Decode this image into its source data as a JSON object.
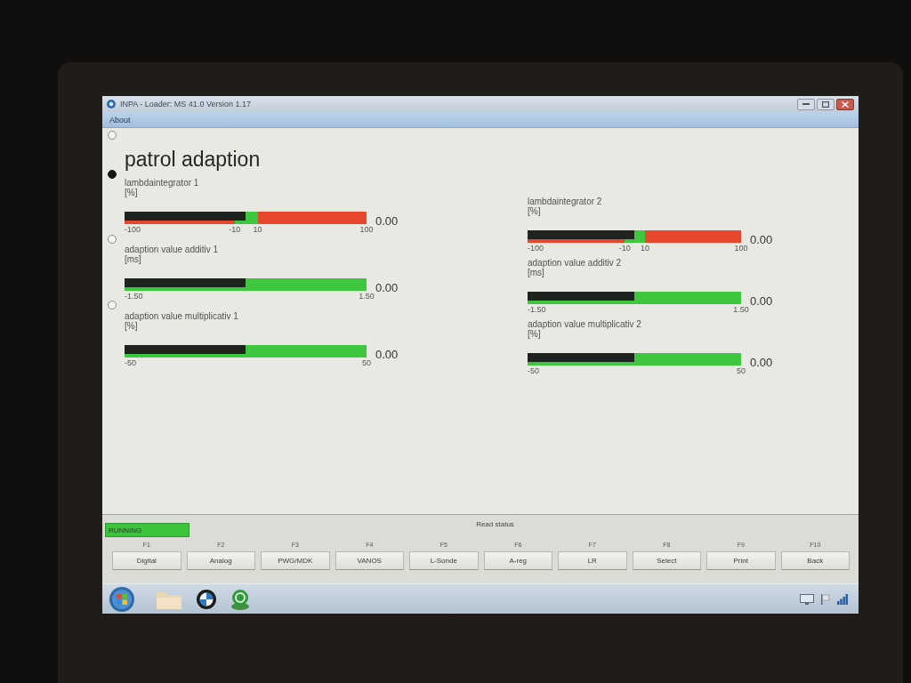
{
  "window": {
    "title": "INPA - Loader: MS 41.0 Version 1.17"
  },
  "menu": [
    "About"
  ],
  "indicators": [
    {
      "selected": false
    },
    {
      "selected": true
    },
    {
      "selected": false
    },
    {
      "selected": false
    }
  ],
  "heading": "patrol adaption",
  "columns": [
    {
      "meters": [
        {
          "kind": "window",
          "label": "lambdaintegrator 1",
          "unit": "[%]",
          "level": 0.5,
          "reading": "0.00",
          "ticks": [
            "-100",
            "-10",
            "10",
            "100"
          ]
        },
        {
          "kind": "full",
          "label": "adaption value additiv 1",
          "unit": "[ms]",
          "level": 0.5,
          "reading": "0.00",
          "ticks": [
            "-1.50",
            "1.50"
          ]
        },
        {
          "kind": "full",
          "label": "adaption value multiplicativ 1",
          "unit": "[%]",
          "level": 0.5,
          "reading": "0.00",
          "ticks": [
            "-50",
            "50"
          ]
        }
      ]
    },
    {
      "meters": [
        {
          "kind": "window",
          "label": "lambdaintegrator 2",
          "unit": "[%]",
          "level": 0.5,
          "reading": "0.00",
          "ticks": [
            "-100",
            "-10",
            "10",
            "100"
          ]
        },
        {
          "kind": "full",
          "label": "adaption value additiv 2",
          "unit": "[ms]",
          "level": 0.5,
          "reading": "0.00",
          "ticks": [
            "-1.50",
            "1.50"
          ]
        },
        {
          "kind": "full",
          "label": "adaption value multiplicativ 2",
          "unit": "[%]",
          "level": 0.5,
          "reading": "0.00",
          "ticks": [
            "-50",
            "50"
          ]
        }
      ]
    }
  ],
  "function_panel": {
    "status": "RUNNING",
    "title": "Read status",
    "keys": [
      {
        "key": "F1",
        "label": "Digital"
      },
      {
        "key": "F2",
        "label": "Analog"
      },
      {
        "key": "F3",
        "label": "PWG/MDK"
      },
      {
        "key": "F4",
        "label": "VANOS"
      },
      {
        "key": "F5",
        "label": "L-Sonde"
      },
      {
        "key": "F6",
        "label": "A-reg"
      },
      {
        "key": "F7",
        "label": "LR"
      },
      {
        "key": "F8",
        "label": "Select"
      },
      {
        "key": "F9",
        "label": "Print"
      },
      {
        "key": "F10",
        "label": "Back"
      }
    ]
  }
}
